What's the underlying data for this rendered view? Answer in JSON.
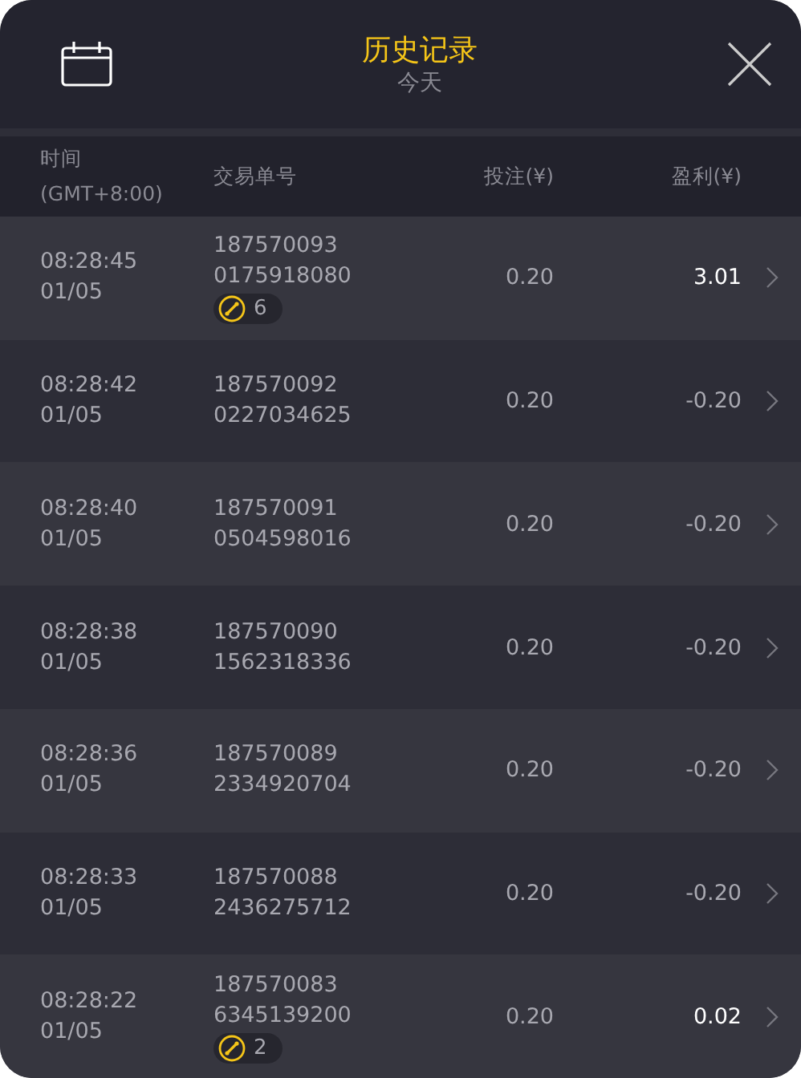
{
  "header": {
    "title": "历史记录",
    "subtitle": "今天"
  },
  "columns": {
    "time": [
      "时间",
      "(GMT+8:00)"
    ],
    "order": "交易单号",
    "bet": "投注(¥)",
    "profit": "盈利(¥)"
  },
  "rows": [
    {
      "time": "08:28:45",
      "date": "01/05",
      "order": [
        "187570093",
        "0175918080"
      ],
      "badge": "6",
      "bet": "0.20",
      "profit": "3.01",
      "win": true
    },
    {
      "time": "08:28:42",
      "date": "01/05",
      "order": [
        "187570092",
        "0227034625"
      ],
      "bet": "0.20",
      "profit": "-0.20",
      "win": false
    },
    {
      "time": "08:28:40",
      "date": "01/05",
      "order": [
        "187570091",
        "0504598016"
      ],
      "bet": "0.20",
      "profit": "-0.20",
      "win": false
    },
    {
      "time": "08:28:38",
      "date": "01/05",
      "order": [
        "187570090",
        "1562318336"
      ],
      "bet": "0.20",
      "profit": "-0.20",
      "win": false
    },
    {
      "time": "08:28:36",
      "date": "01/05",
      "order": [
        "187570089",
        "2334920704"
      ],
      "bet": "0.20",
      "profit": "-0.20",
      "win": false
    },
    {
      "time": "08:28:33",
      "date": "01/05",
      "order": [
        "187570088",
        "2436275712"
      ],
      "bet": "0.20",
      "profit": "-0.20",
      "win": false
    },
    {
      "time": "08:28:22",
      "date": "01/05",
      "order": [
        "187570083",
        "6345139200"
      ],
      "badge": "2",
      "bet": "0.20",
      "profit": "0.02",
      "win": true
    }
  ]
}
